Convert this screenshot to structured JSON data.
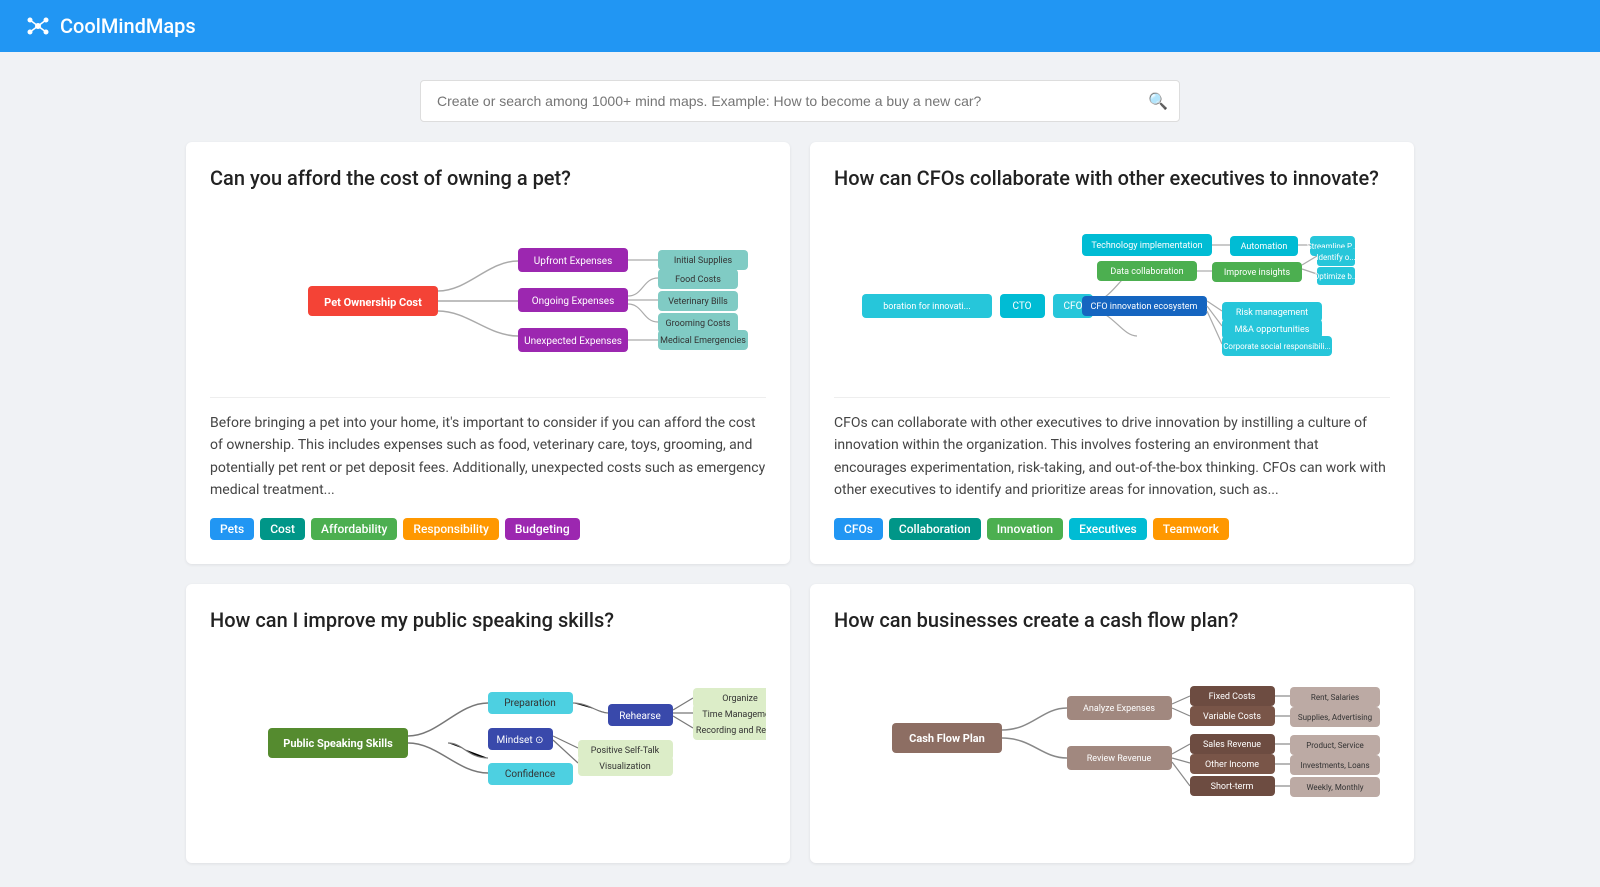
{
  "header": {
    "logo_text": "CoolMindMaps",
    "logo_icon": "✦"
  },
  "search": {
    "placeholder": "Create or search among 1000+ mind maps. Example: How to become a buy a new car?"
  },
  "cards": [
    {
      "id": "pet-ownership",
      "title": "Can you afford the cost of owning a pet?",
      "description": "Before bringing a pet into your home, it's important to consider if you can afford the cost of ownership. This includes expenses such as food, veterinary care, toys, grooming, and potentially pet rent or pet deposit fees. Additionally, unexpected costs such as emergency medical treatment...",
      "tags": [
        {
          "label": "Pets",
          "color": "tag-blue"
        },
        {
          "label": "Cost",
          "color": "tag-teal"
        },
        {
          "label": "Affordability",
          "color": "tag-green"
        },
        {
          "label": "Responsibility",
          "color": "tag-orange"
        },
        {
          "label": "Budgeting",
          "color": "tag-purple"
        }
      ]
    },
    {
      "id": "cfo-collaborate",
      "title": "How can CFOs collaborate with other executives to innovate?",
      "description": "CFOs can collaborate with other executives to drive innovation by instilling a culture of innovation within the organization. This involves fostering an environment that encourages experimentation, risk-taking, and out-of-the-box thinking. CFOs can work with other executives to identify and prioritize areas for innovation, such as...",
      "tags": [
        {
          "label": "CFOs",
          "color": "tag-blue"
        },
        {
          "label": "Collaboration",
          "color": "tag-teal"
        },
        {
          "label": "Innovation",
          "color": "tag-green"
        },
        {
          "label": "Executives",
          "color": "tag-cyan"
        },
        {
          "label": "Teamwork",
          "color": "tag-orange"
        }
      ]
    },
    {
      "id": "public-speaking",
      "title": "How can I improve my public speaking skills?",
      "description": "",
      "tags": []
    },
    {
      "id": "cash-flow",
      "title": "How can businesses create a cash flow plan?",
      "description": "",
      "tags": []
    }
  ]
}
